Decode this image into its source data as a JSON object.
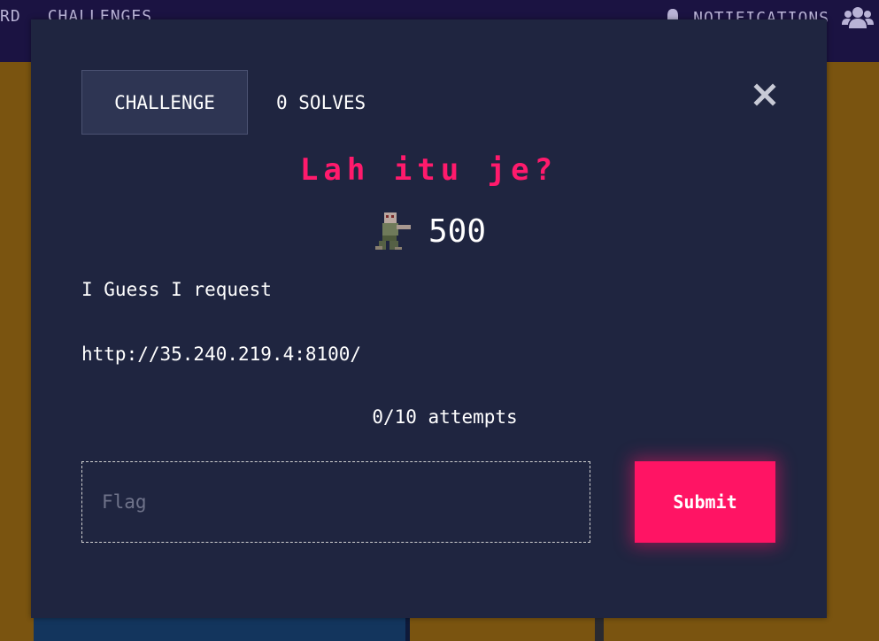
{
  "nav": {
    "left_items": [
      "RD",
      "CHALLENGES"
    ],
    "notifications_label": "NOTIFICATIONS",
    "icons": [
      "bell-icon",
      "users-icon"
    ]
  },
  "modal": {
    "tabs": {
      "challenge": "CHALLENGE",
      "solves": "0 SOLVES"
    },
    "title": "Lah itu je?",
    "points": "500",
    "description_line1": "I Guess I request",
    "description_line2": "http://35.240.219.4:8100/",
    "attempts": "0/10 attempts",
    "flag_placeholder": "Flag",
    "flag_value": "",
    "submit_label": "Submit"
  },
  "colors": {
    "accent": "#ff1464",
    "modal_bg": "#1f2540",
    "navbar_bg": "#1b1342",
    "page_bg": "#7a5410"
  }
}
